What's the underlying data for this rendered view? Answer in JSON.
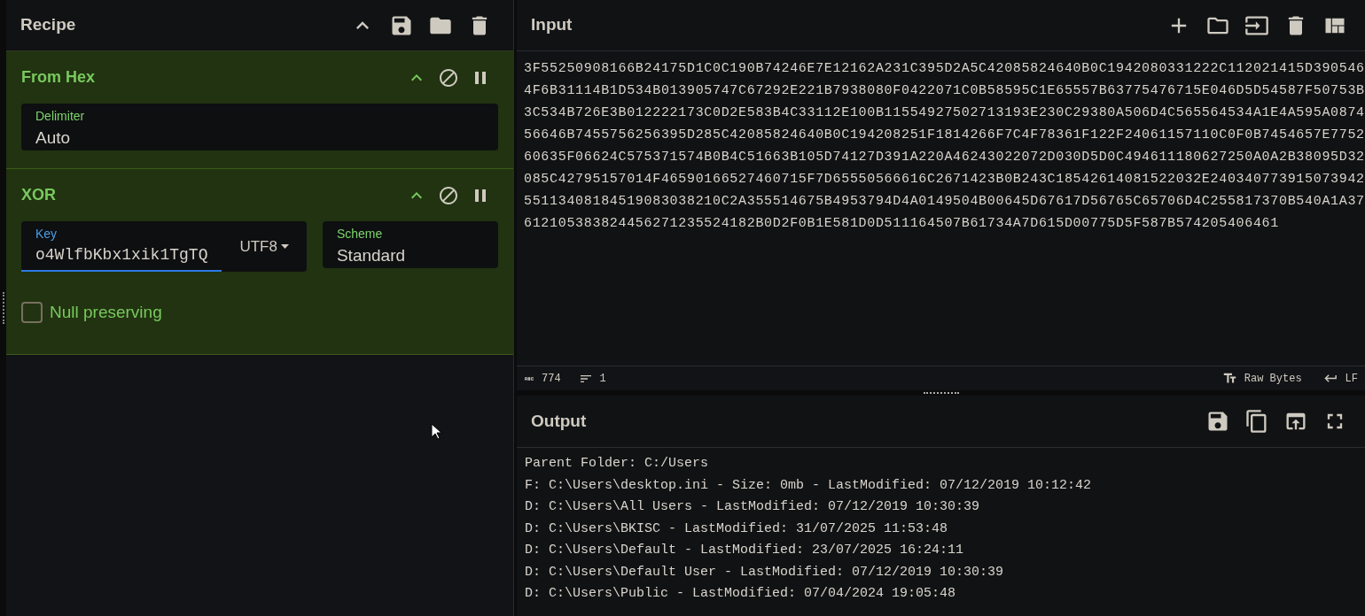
{
  "recipe": {
    "title": "Recipe",
    "operations": [
      {
        "name": "From Hex",
        "fields": [
          {
            "kind": "text",
            "label": "Delimiter",
            "value": "Auto",
            "focused": false
          }
        ]
      },
      {
        "name": "XOR",
        "fields": [
          {
            "kind": "key",
            "label": "Key",
            "value": "o4WlfbKbx1xik1TgTQ",
            "encoding": "UTF8",
            "focused": true
          },
          {
            "kind": "text",
            "label": "Scheme",
            "value": "Standard",
            "focused": false
          }
        ],
        "options": [
          {
            "label": "Null preserving",
            "checked": false
          }
        ]
      }
    ]
  },
  "input": {
    "title": "Input",
    "lines": [
      "3F55250908166B24175D1C0C190B74246E7E12162A231C395D2A5C42085824640B0C1942080331222C112021415D390546",
      "4F6B31114B1D534B013905747C67292E221B7938080F0422071C0B58595C1E65557B63775476715E046D5D54587F50753B",
      "3C534B726E3B012222173C0D2E583B4C33112E100B11554927502713193E230C29380A506D4C565564534A1E4A595A0874",
      "56646B7455756256395D285C42085824640B0C194208251F1814266F7C4F78361F122F24061157110C0F0B7454657E7752",
      "60635F06624C575371574B0B4C51663B105D74127D391A220A46243022072D030D5D0C494611180627250A0A2B38095D32",
      "085C42795157014F46590166527460715F7D65550566616C2671423B0B243C18542614081522032E240340773915073942",
      "55113408184519083038210C2A355514675B4953794D4A0149504B00645D67617D56765C65706D4C255817370B540A1A37",
      "612105383824456271235524182B0D2F0B1E581D0D511164507B61734A7D615D00775D5F587B574205406461"
    ],
    "status": {
      "length": "774",
      "lines": "1",
      "encoding": "Raw Bytes",
      "eol": "LF"
    }
  },
  "output": {
    "title": "Output",
    "lines": [
      "Parent Folder: C:/Users",
      "F: C:\\Users\\desktop.ini - Size: 0mb - LastModified: 07/12/2019 10:12:42",
      "D: C:\\Users\\All Users - LastModified: 07/12/2019 10:30:39",
      "D: C:\\Users\\BKISC - LastModified: 31/07/2025 11:53:48",
      "D: C:\\Users\\Default - LastModified: 23/07/2025 16:24:11",
      "D: C:\\Users\\Default User - LastModified: 07/12/2019 10:30:39",
      "D: C:\\Users\\Public - LastModified: 07/04/2024 19:05:48"
    ]
  }
}
